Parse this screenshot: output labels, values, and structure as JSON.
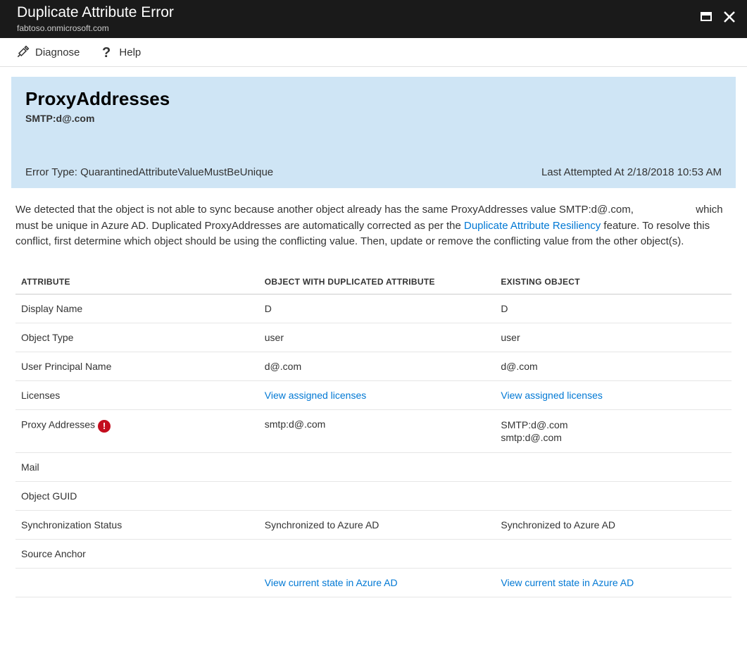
{
  "titlebar": {
    "title": "Duplicate Attribute Error",
    "subtitle": "fabtoso.onmicrosoft.com"
  },
  "toolbar": {
    "diagnose": "Diagnose",
    "help": "Help"
  },
  "summary": {
    "title": "ProxyAddresses",
    "value": "SMTP:d@.com",
    "error_type_label": "Error Type: QuarantinedAttributeValueMustBeUnique",
    "last_attempted_label": "Last Attempted At 2/18/2018 10:53 AM"
  },
  "description": {
    "text1": "We detected that the object is not able to sync because another object already has the same ProxyAddresses value SMTP:d@.com,",
    "text2": "which must be unique in Azure AD. Duplicated ProxyAddresses are automatically corrected as per the ",
    "link": "Duplicate Attribute Resiliency",
    "text3": " feature. To resolve this conflict, first determine which object should be using the conflicting value. Then, update or remove the conflicting value from the other object(s)."
  },
  "table": {
    "headers": {
      "attribute": "ATTRIBUTE",
      "duplicated": "OBJECT WITH DUPLICATED ATTRIBUTE",
      "existing": "EXISTING OBJECT"
    },
    "rows": [
      {
        "attr": "Display Name",
        "dup": "D",
        "exist": "D"
      },
      {
        "attr": "Object Type",
        "dup": "user",
        "exist": "user"
      },
      {
        "attr": "User Principal Name",
        "dup": "d@.com",
        "exist": "d@.com"
      },
      {
        "attr": "Licenses",
        "dup": "View assigned licenses",
        "exist": "View assigned licenses",
        "link": true
      },
      {
        "attr": "Proxy Addresses",
        "error": true,
        "dup": "smtp:d@.com",
        "exist_multi": [
          "SMTP:d@.com",
          "smtp:d@.com"
        ]
      },
      {
        "attr": "Mail",
        "dup": "",
        "exist": ""
      },
      {
        "attr": "Object GUID",
        "dup": "",
        "exist": ""
      },
      {
        "attr": "Synchronization Status",
        "dup": "Synchronized to Azure AD",
        "exist": "Synchronized to Azure AD"
      },
      {
        "attr": "Source Anchor",
        "dup": "",
        "exist": ""
      },
      {
        "attr": "",
        "dup": "View current state in Azure AD",
        "exist": "View current state in Azure AD",
        "link": true
      }
    ]
  }
}
